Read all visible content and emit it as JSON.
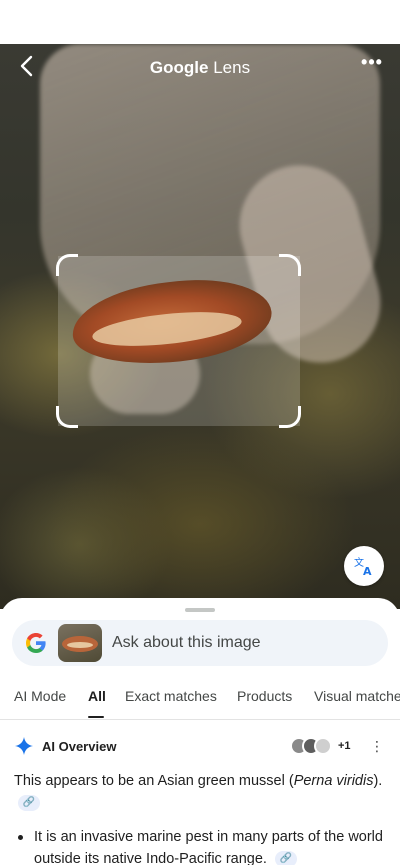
{
  "header": {
    "title_google": "Google",
    "title_lens": "Lens",
    "more_label": "•••"
  },
  "search": {
    "placeholder": "Ask about this image"
  },
  "tabs": [
    {
      "label": "AI Mode"
    },
    {
      "label": "All"
    },
    {
      "label": "Exact matches"
    },
    {
      "label": "Products"
    },
    {
      "label": "Visual matches"
    }
  ],
  "ai_overview": {
    "label": "AI Overview",
    "source_count": "+1",
    "answer_prefix": "This appears to be an Asian green mussel (",
    "answer_species": "Perna viridis",
    "answer_suffix": ").",
    "bullet": "It is an invasive marine pest in many parts of the world outside its native Indo-Pacific range."
  },
  "colors": {
    "google_blue": "#4285F4",
    "google_red": "#EA4335",
    "google_yellow": "#FBBC05",
    "google_green": "#34A853",
    "accent_blue": "#1a73e8"
  }
}
